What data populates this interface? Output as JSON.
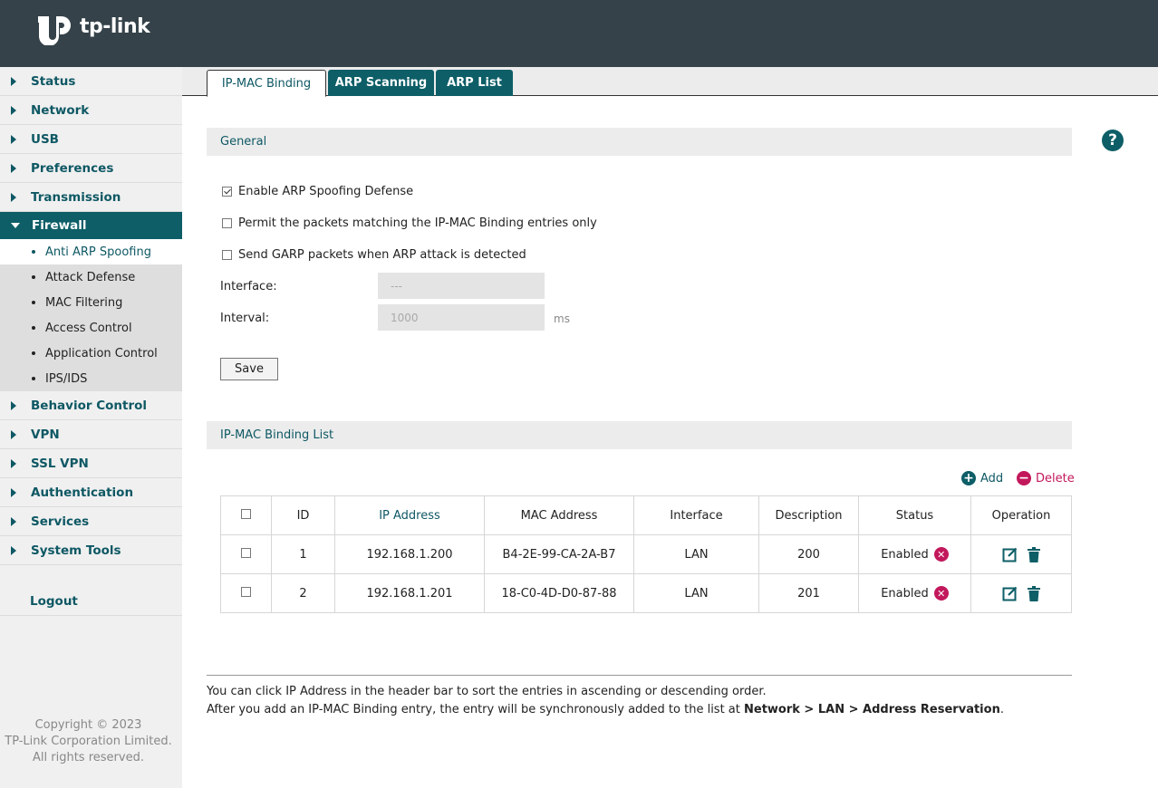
{
  "brand": {
    "logo_text": "tp-link"
  },
  "sidebar": {
    "items_top": [
      {
        "label": "Status"
      },
      {
        "label": "Network"
      },
      {
        "label": "USB"
      },
      {
        "label": "Preferences"
      },
      {
        "label": "Transmission"
      }
    ],
    "active_item": {
      "label": "Firewall"
    },
    "sub_items": [
      {
        "label": "Anti ARP Spoofing",
        "active": true
      },
      {
        "label": "Attack Defense"
      },
      {
        "label": "MAC Filtering"
      },
      {
        "label": "Access Control"
      },
      {
        "label": "Application Control"
      },
      {
        "label": "IPS/IDS"
      }
    ],
    "items_bottom": [
      {
        "label": "Behavior Control"
      },
      {
        "label": "VPN"
      },
      {
        "label": "SSL VPN"
      },
      {
        "label": "Authentication"
      },
      {
        "label": "Services"
      },
      {
        "label": "System Tools"
      }
    ],
    "logout": "Logout",
    "copyright": [
      "Copyright © 2023",
      "TP-Link Corporation Limited.",
      "All rights reserved."
    ]
  },
  "tabs": [
    {
      "label": "IP-MAC Binding",
      "active": true
    },
    {
      "label": "ARP Scanning"
    },
    {
      "label": "ARP List"
    }
  ],
  "help_glyph": "?",
  "general": {
    "title": "General",
    "options": [
      {
        "label": "Enable ARP Spoofing Defense",
        "checked": true
      },
      {
        "label": "Permit the packets matching the IP-MAC Binding entries only",
        "checked": false
      },
      {
        "label": "Send GARP packets when ARP attack is detected",
        "checked": false
      }
    ],
    "interface_label": "Interface:",
    "interface_value": "---",
    "interval_label": "Interval:",
    "interval_value": "1000",
    "interval_unit": "ms",
    "save_label": "Save"
  },
  "binding_list": {
    "title": "IP-MAC Binding List",
    "add_label": "Add",
    "delete_label": "Delete",
    "columns": [
      "ID",
      "IP Address",
      "MAC Address",
      "Interface",
      "Description",
      "Status",
      "Operation"
    ],
    "rows": [
      {
        "id": "1",
        "ip": "192.168.1.200",
        "mac": "B4-2E-99-CA-2A-B7",
        "interface": "LAN",
        "description": "200",
        "status": "Enabled"
      },
      {
        "id": "2",
        "ip": "192.168.1.201",
        "mac": "18-C0-4D-D0-87-88",
        "interface": "LAN",
        "description": "201",
        "status": "Enabled"
      }
    ]
  },
  "notes": {
    "line1": "You can click IP Address in the header bar to sort the entries in ascending or descending order.",
    "line2_prefix": "After you add an IP-MAC Binding entry, the entry will be synchronously added to the list at ",
    "line2_bold": "Network > LAN > Address Reservation",
    "line2_suffix": "."
  },
  "colors": {
    "header": "#354249",
    "accent": "#0d5e67",
    "delete": "#c2185b"
  }
}
